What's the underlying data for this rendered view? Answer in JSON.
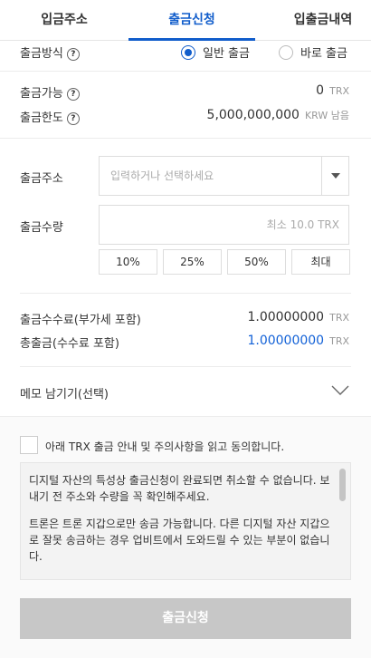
{
  "tabs": [
    "입금주소",
    "출금신청",
    "입출금내역"
  ],
  "method": {
    "label": "출금방식",
    "options": [
      "일반 출금",
      "바로 출금"
    ],
    "selected": "일반 출금"
  },
  "available": {
    "label": "출금가능",
    "value": "0",
    "unit": "TRX"
  },
  "limit": {
    "label": "출금한도",
    "value": "5,000,000,000",
    "unit": "KRW 남음"
  },
  "address": {
    "label": "출금주소",
    "placeholder": "입력하거나 선택하세요"
  },
  "amount": {
    "label": "출금수량",
    "placeholder": "최소 10.0 TRX"
  },
  "quick_buttons": [
    "10%",
    "25%",
    "50%",
    "최대"
  ],
  "fee": {
    "label": "출금수수료(부가세 포함)",
    "value": "1.00000000",
    "unit": "TRX"
  },
  "total": {
    "label": "총출금(수수료 포함)",
    "value": "1.00000000",
    "unit": "TRX"
  },
  "memo": {
    "label": "메모 남기기(선택)"
  },
  "agree": {
    "label": "아래 TRX 출금 안내 및 주의사항을 읽고 동의합니다."
  },
  "notice": [
    "디지털 자산의 특성상 출금신청이 완료되면 취소할 수 없습니다. 보내기 전 주소와 수량을 꼭 확인해주세요.",
    "트론은 트론 지갑으로만 송금 가능합니다. 다른 디지털 자산 지갑으로 잘못 송금하는 경우 업비트에서 도와드릴 수 있는 부분이 없습니다."
  ],
  "submit": {
    "label": "출금신청"
  },
  "colors": {
    "accent": "#115dcb",
    "total_value": "#1261d7",
    "button_disabled": "#c7c7c7"
  }
}
